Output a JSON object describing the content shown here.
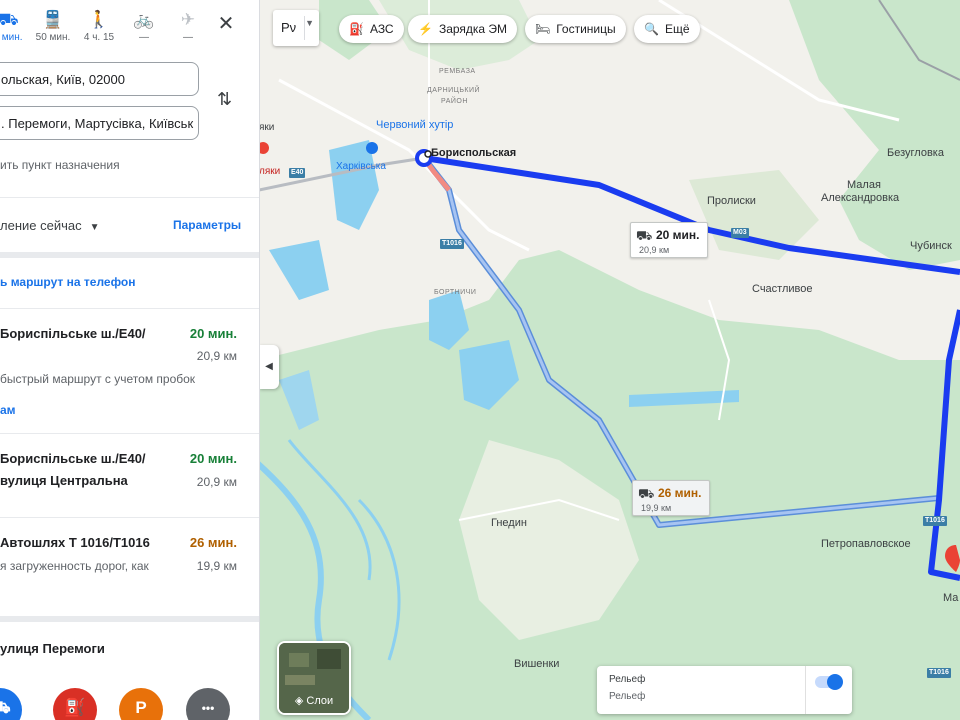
{
  "colors": {
    "accent": "#1a73e8",
    "route_main": "#1a3cf0",
    "route_alt": "#7fa5e8",
    "time_green": "#188038",
    "time_orange": "#b06000",
    "forest": "#c9e6cb",
    "water": "#8cd0f0"
  },
  "panel": {
    "modes": [
      {
        "icon": "car-icon",
        "label": "0 мин."
      },
      {
        "icon": "train-icon",
        "label": "50 мин."
      },
      {
        "icon": "walk-icon",
        "label": "4 ч. 15"
      },
      {
        "icon": "bike-icon",
        "label": "—"
      },
      {
        "icon": "plane-icon",
        "label": "—"
      }
    ],
    "origin": "ольская, Київ, 02000",
    "destination": ". Перемоги, Мартусівка, Київськ",
    "add_destination": "ить пункт назначения",
    "depart": "ление сейчас",
    "params": "Параметры",
    "send_to_phone": "ь маршрут на телефон",
    "routes": [
      {
        "via": "Бориспільське ш./E40/",
        "time": "20 мин.",
        "distance": "20,9 км",
        "note": "быстрый маршрут с учетом пробок",
        "link": "ам"
      },
      {
        "via": "Бориспільське ш./E40/",
        "via2": "вулиця Центральна",
        "time": "20 мин.",
        "distance": "20,9 км"
      },
      {
        "via": "Автошлях Т 1016/Т1016",
        "time": "26 мин.",
        "distance": "19,9 км",
        "note": "я загруженность дорог, как"
      }
    ],
    "destination_name": "улиця Перемоги",
    "poi_buttons": [
      {
        "icon": "hotel-icon",
        "color": "#1a73e8",
        "glyph": "⛟"
      },
      {
        "icon": "gas-station-icon",
        "color": "#d93025",
        "glyph": "⛽"
      },
      {
        "icon": "parking-icon",
        "color": "#e8710a",
        "glyph": "P"
      },
      {
        "icon": "more-icon",
        "color": "#5f6368",
        "glyph": "•••"
      }
    ]
  },
  "map": {
    "lang_button": "Рν",
    "chips": [
      {
        "icon": "gas-station-icon",
        "glyph": "⛽",
        "label": "АЗС"
      },
      {
        "icon": "ev-charging-icon",
        "glyph": "⚡",
        "label": "Зарядка ЭМ"
      },
      {
        "icon": "hotel-icon",
        "glyph": "🛏",
        "label": "Гостиницы"
      },
      {
        "icon": "search-icon",
        "glyph": "🔍",
        "label": "Ещё"
      }
    ],
    "route_boxes": [
      {
        "time": "20 мин.",
        "distance": "20,9 км"
      },
      {
        "time": "26 мин.",
        "distance": "19,9 км"
      }
    ],
    "places": {
      "borispolskaya": "Бориспольская",
      "proliski": "Пролиски",
      "bezuglovka": "Безугловка",
      "malaya_alex": "Малая",
      "malaya_alex2": "Александровка",
      "chubinsk": "Чубинск",
      "schastlivoe": "Счастливое",
      "gnedin": "Гнедин",
      "petropavl": "Петропавловское",
      "vishenki": "Вишенки",
      "chervoniy": "Червоний хутір",
      "kharkivska": "Харківська",
      "rembaza": "РЕМБАЗА",
      "darnitsky": "ДАРНИЦЬКИЙ",
      "rayon": "РАЙОН",
      "bortnichi": "БОРТНИЧИ",
      "yaki": "яки",
      "yaki2": "ляки",
      "ma": "Ма"
    },
    "shields": [
      "E40",
      "T1016",
      "M03",
      "T1016",
      "T1016"
    ],
    "layers_label": "Слои",
    "relief_title": "Рельеф",
    "relief_sub": "Рельеф",
    "relief_on": true
  }
}
